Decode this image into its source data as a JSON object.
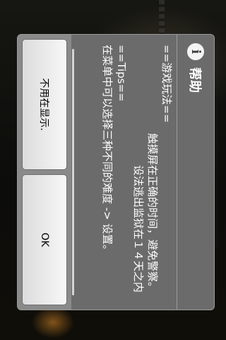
{
  "dialog": {
    "title": "帮助",
    "icon": "info-icon",
    "lines": [
      "==游戏玩法==",
      "触摸屏在正确的时间，避免警察。",
      "设法逃出监狱在１４天之内",
      "==Tips==",
      "在菜单中可以选择三种不同的难度 -> 设置。"
    ],
    "buttons": {
      "positive": "不用在显示.",
      "negative": "OK"
    }
  },
  "colors": {
    "dialog_bg": "#6b6b6b",
    "button_bar_bg": "#8a8a8a",
    "text": "#ffffff"
  }
}
